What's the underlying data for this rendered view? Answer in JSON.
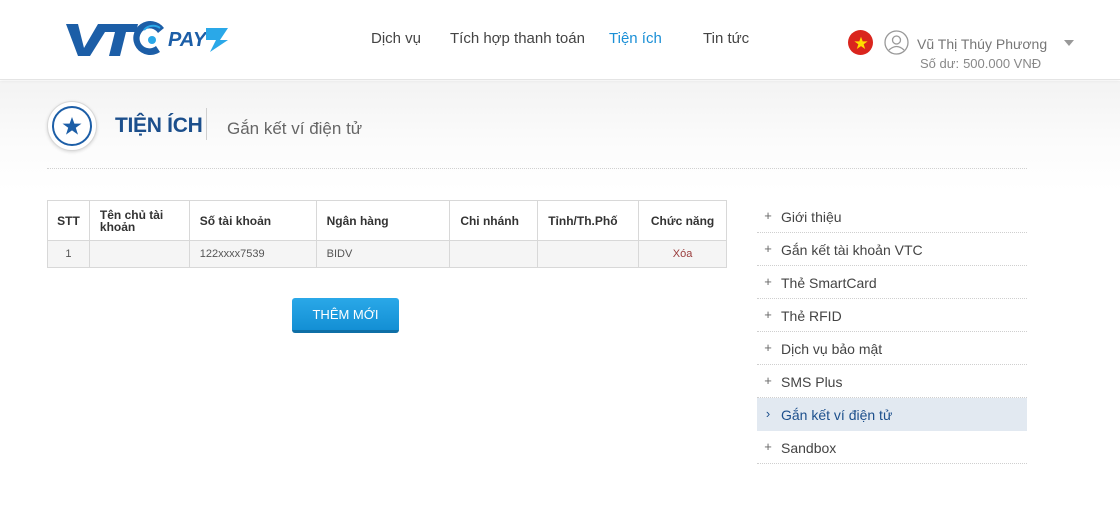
{
  "header": {
    "nav": [
      {
        "label": "Dịch vụ",
        "active": false
      },
      {
        "label": "Tích hợp thanh toán",
        "active": false
      },
      {
        "label": "Tiện ích",
        "active": true
      },
      {
        "label": "Tin tức",
        "active": false
      }
    ],
    "user_name": "Vũ Thị Thúy Phương",
    "balance_label": "Số dư:",
    "balance_value": "500.000 VNĐ"
  },
  "page": {
    "title": "TIỆN ÍCH",
    "subtitle": "Gắn kết ví điện tử"
  },
  "table": {
    "columns": [
      "STT",
      "Tên chủ tài khoản",
      "Số tài khoản",
      "Ngân hàng",
      "Chi nhánh",
      "Tỉnh/Th.Phố",
      "Chức năng"
    ],
    "rows": [
      {
        "stt": "1",
        "owner": "",
        "account": "122xxxx7539",
        "bank": "BIDV",
        "branch": "",
        "city": "",
        "action": "Xóa"
      }
    ]
  },
  "add_button": "THÊM MỚI",
  "side_menu": [
    {
      "label": "Giới thiệu",
      "active": false
    },
    {
      "label": "Gắn kết tài khoản VTC",
      "active": false
    },
    {
      "label": "Thẻ SmartCard",
      "active": false
    },
    {
      "label": "Thẻ RFID",
      "active": false
    },
    {
      "label": "Dịch vụ bảo mật",
      "active": false
    },
    {
      "label": "SMS Plus",
      "active": false
    },
    {
      "label": "Gắn kết ví điện tử",
      "active": true
    },
    {
      "label": "Sandbox",
      "active": false
    }
  ],
  "side_marks": {
    "collapsed": "+",
    "expanded": "›"
  },
  "colors": {
    "brand_blue": "#1c4f8c",
    "accent": "#1a8fd6",
    "button": "#1a9ae0",
    "flag_red": "#da251d",
    "flag_star": "#ffde00"
  },
  "icons": {
    "logo": "vtc-pay-logo",
    "flag": "vietnam-flag-icon",
    "user": "user-icon",
    "badge": "star-icon",
    "caret": "caret-down-icon"
  }
}
